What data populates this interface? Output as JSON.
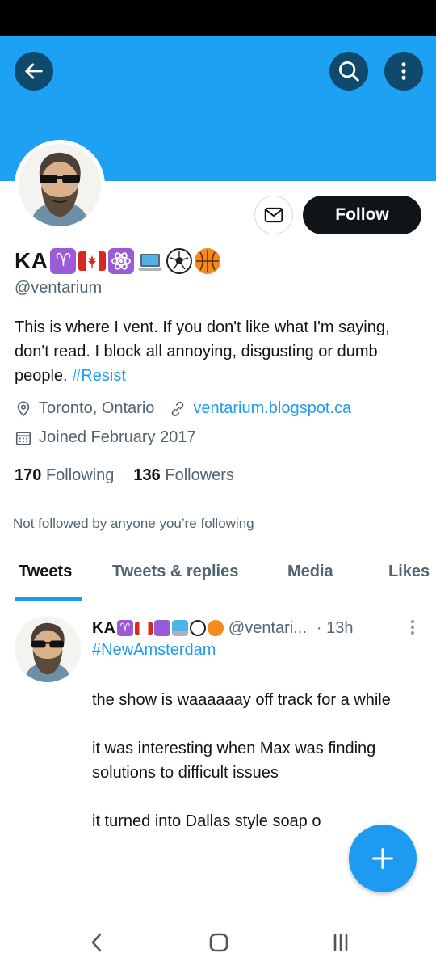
{
  "profile": {
    "display_name": "KA",
    "name_emojis": [
      "aries",
      "canada-flag",
      "atom",
      "laptop",
      "soccer-ball",
      "basketball"
    ],
    "handle": "@ventarium",
    "bio_text": "This is where I vent. If you don't like what I'm saying, don't read. I block all annoying, disgusting or dumb people.",
    "bio_hashtag": "#Resist",
    "location": "Toronto, Ontario",
    "website": "ventarium.blogspot.ca",
    "joined": "Joined February 2017",
    "following_count": "170",
    "following_label": "Following",
    "followers_count": "136",
    "followers_label": "Followers",
    "not_followed_note": "Not followed by anyone you’re following"
  },
  "actions": {
    "follow_label": "Follow"
  },
  "tabs": [
    {
      "label": "Tweets",
      "active": true
    },
    {
      "label": "Tweets & replies",
      "active": false
    },
    {
      "label": "Media",
      "active": false
    },
    {
      "label": "Likes",
      "active": false
    }
  ],
  "tweet": {
    "author_name": "KA",
    "author_handle": "@ventari...",
    "time": "· 13h",
    "hashtag": "#NewAmsterdam",
    "paragraphs": [
      "the show is waaaaaay off track for a while",
      "it was interesting when Max was finding solutions to difficult issues",
      "it turned into Dallas style soap o"
    ]
  },
  "colors": {
    "banner": "#1da1f2",
    "accent": "#1d9bf0",
    "text": "#0f1419",
    "secondary": "#536471"
  },
  "icons": {
    "back": "arrow-left-icon",
    "search": "search-icon",
    "more": "more-vertical-icon",
    "mail": "mail-icon",
    "location": "location-pin-icon",
    "link": "link-icon",
    "calendar": "calendar-icon",
    "compose": "plus-icon"
  }
}
